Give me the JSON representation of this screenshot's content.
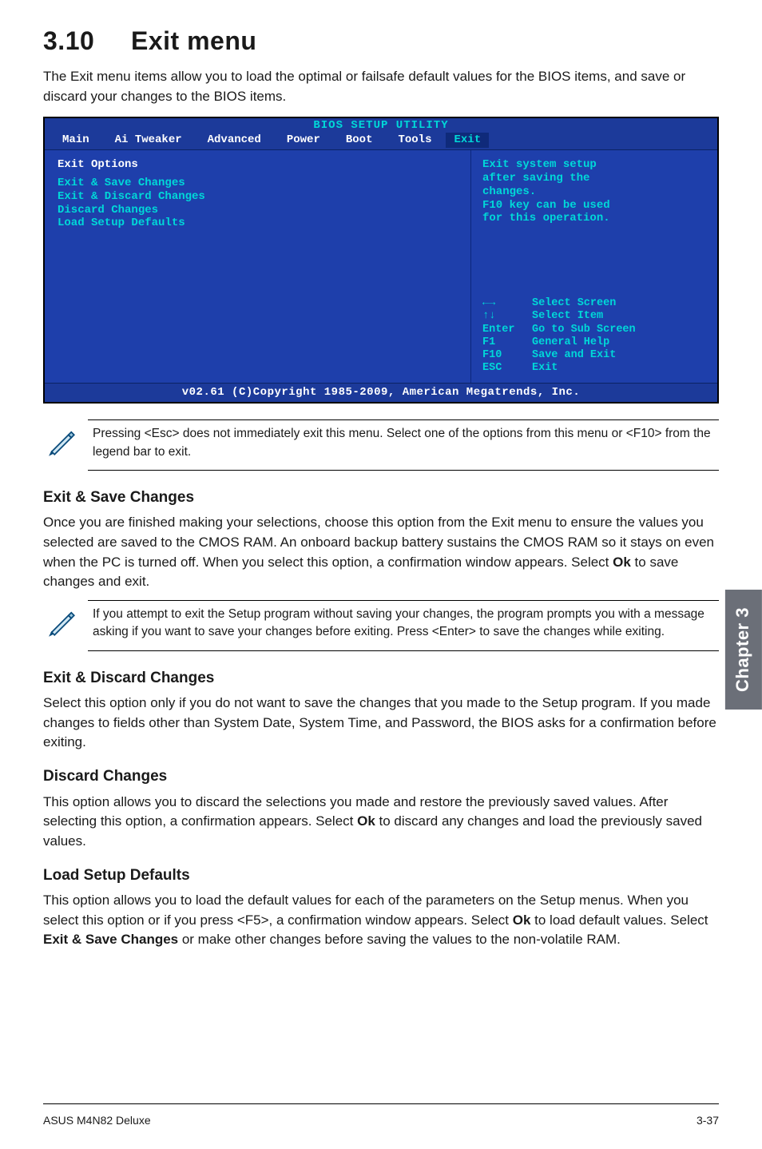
{
  "section": {
    "number": "3.10",
    "title": "Exit menu"
  },
  "intro": "The Exit menu items allow you to load the optimal or failsafe default values for the BIOS items, and save or discard your changes to the BIOS items.",
  "bios": {
    "utility_title": "BIOS SETUP UTILITY",
    "tabs": [
      "Main",
      "Ai Tweaker",
      "Advanced",
      "Power",
      "Boot",
      "Tools",
      "Exit"
    ],
    "left_header": "Exit Options",
    "items": [
      "Exit & Save Changes",
      "Exit & Discard Changes",
      "Discard Changes",
      "",
      "Load Setup Defaults"
    ],
    "right_help_lines": [
      "Exit system setup",
      "after saving the",
      "changes.",
      "",
      "F10 key can be used",
      "for this operation."
    ],
    "key_help": [
      {
        "key": "←→",
        "desc": "Select Screen"
      },
      {
        "key": "↑↓",
        "desc": "Select Item"
      },
      {
        "key": "Enter",
        "desc": "Go to Sub Screen"
      },
      {
        "key": "F1",
        "desc": "General Help"
      },
      {
        "key": "F10",
        "desc": "Save and Exit"
      },
      {
        "key": "ESC",
        "desc": "Exit"
      }
    ],
    "footer": "v02.61 (C)Copyright 1985-2009, American Megatrends, Inc."
  },
  "note1": "Pressing <Esc> does not immediately exit this menu. Select one of the options from this menu or <F10> from the legend bar to exit.",
  "sections": {
    "save": {
      "title": "Exit & Save Changes",
      "body_parts": [
        "Once you are finished making your selections, choose this option from the Exit menu to ensure the values you selected are saved to the CMOS RAM. An onboard backup battery sustains the CMOS RAM so it stays on even when the PC is turned off. When you select this option, a confirmation window appears. Select ",
        "Ok",
        " to save changes and exit."
      ]
    },
    "note2": "If you attempt to exit the Setup program without saving your changes, the program prompts you with a message asking if you want to save your changes before exiting. Press <Enter> to save the changes while exiting.",
    "discard": {
      "title": "Exit & Discard Changes",
      "body": "Select this option only if you do not want to save the changes that you  made to the Setup program. If you made changes to fields other than System Date, System Time, and Password, the BIOS asks for a confirmation before exiting."
    },
    "disc_changes": {
      "title": "Discard Changes",
      "body_parts": [
        "This option allows you to discard the selections you made and restore the previously saved values. After selecting this option, a confirmation appears. Select ",
        "Ok",
        " to discard any changes and load the previously saved values."
      ]
    },
    "load": {
      "title": "Load Setup Defaults",
      "body_parts": [
        "This option allows you to load the default values for each of the parameters on the Setup menus. When you select this option or if you press <F5>, a confirmation window appears. Select ",
        "Ok",
        " to load default values. Select ",
        "Exit & Save Changes",
        " or make other changes before saving the values to the non-volatile RAM."
      ]
    }
  },
  "sidebar_label": "Chapter 3",
  "footer": {
    "left": "ASUS M4N82 Deluxe",
    "right": "3-37"
  }
}
